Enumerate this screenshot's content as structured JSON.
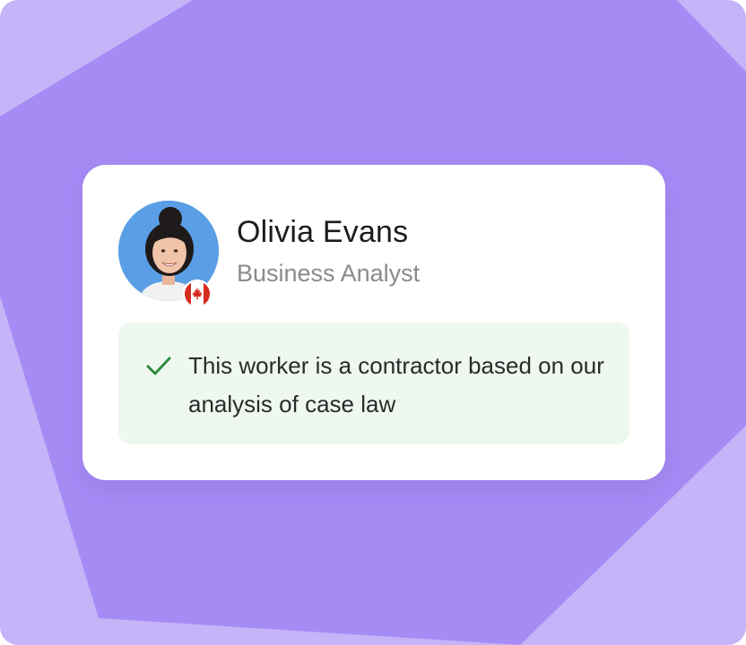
{
  "profile": {
    "name": "Olivia Evans",
    "title": "Business Analyst",
    "country_flag_icon": "canada-flag-icon"
  },
  "status": {
    "icon": "checkmark-icon",
    "message": "This worker is a contractor based on our analysis of case law"
  },
  "colors": {
    "background_dark": "#a78bf5",
    "background_light": "#c4b4f8",
    "card": "#ffffff",
    "status_bg": "#eef8ee",
    "check": "#2e8b3e",
    "avatar_bg": "#5a9ee6"
  }
}
